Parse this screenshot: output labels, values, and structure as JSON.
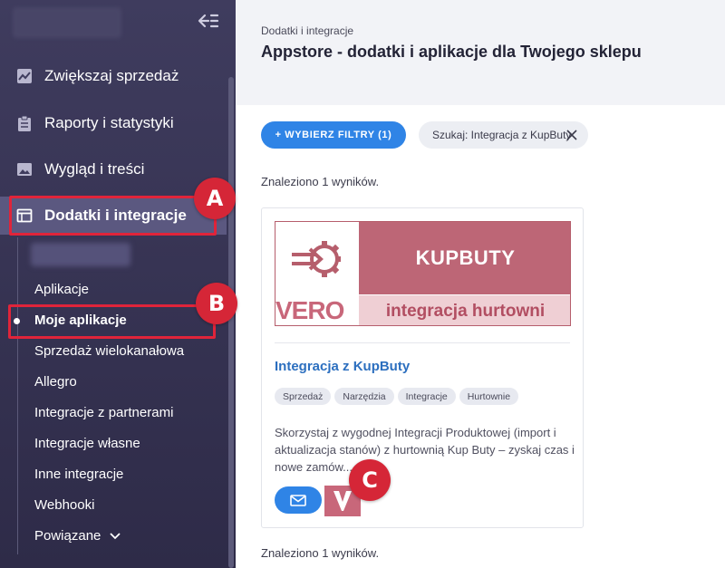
{
  "sidebar": {
    "items": [
      {
        "label": "Zwiększaj sprzedaż",
        "icon": "chart-line-icon"
      },
      {
        "label": "Raporty i statystyki",
        "icon": "clipboard-icon"
      },
      {
        "label": "Wygląd i treści",
        "icon": "image-icon"
      },
      {
        "label": "Dodatki i integracje",
        "icon": "window-icon"
      }
    ],
    "subitems": [
      {
        "label": "Aplikacje"
      },
      {
        "label": "Moje aplikacje"
      },
      {
        "label": "Sprzedaż wielokanałowa"
      },
      {
        "label": "Allegro"
      },
      {
        "label": "Integracje z partnerami"
      },
      {
        "label": "Integracje własne"
      },
      {
        "label": "Inne integracje"
      },
      {
        "label": "Webhooki"
      },
      {
        "label": "Powiązane"
      }
    ]
  },
  "badges": {
    "a": "A",
    "b": "B",
    "c": "C"
  },
  "header": {
    "breadcrumb": "Dodatki i integracje",
    "title": "Appstore - dodatki i aplikacje dla Twojego sklepu"
  },
  "filters": {
    "button_label": "+ WYBIERZ FILTRY (1)",
    "search_chip": "Szukaj: Integracja z KupButy"
  },
  "results": {
    "top": "Znaleziono 1 wyników.",
    "bottom": "Znaleziono 1 wyników."
  },
  "card": {
    "banner_top": "KUPBUTY",
    "banner_bottom": "integracja hurtowni",
    "banner_logo": "VERO",
    "title": "Integracja z KupButy",
    "tags": [
      "Sprzedaż",
      "Narzędzia",
      "Integracje",
      "Hurtownie"
    ],
    "description": "Skorzystaj z wygodnej Integracji Produktowej (import i aktualizacja stanów) z hurtownią Kup Buty – zyskaj czas i nowe zamów..."
  },
  "colors": {
    "sidebar_bg": "#3f3c5e",
    "accent_blue": "#2f84e6",
    "highlight_red": "#e0243a",
    "banner_pink": "#bd6676"
  }
}
